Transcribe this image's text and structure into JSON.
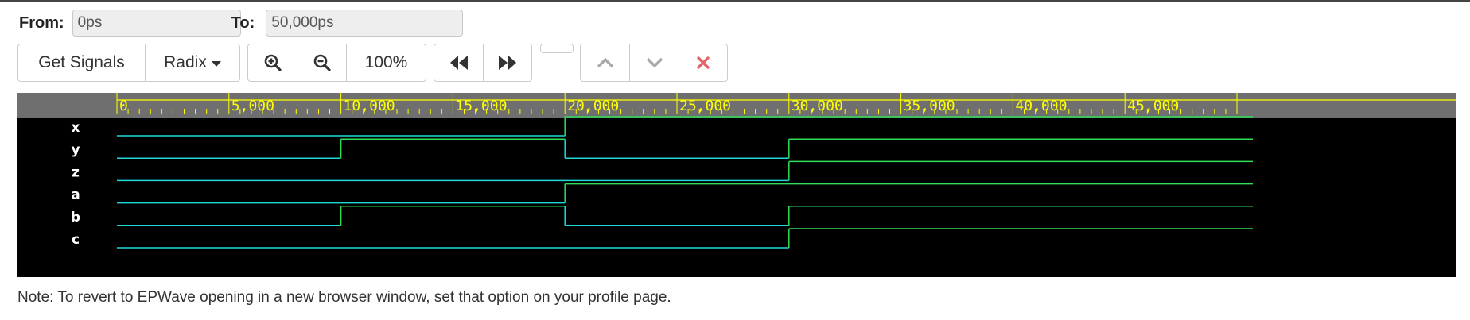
{
  "range": {
    "from_label": "From:",
    "from_value": "0ps",
    "to_label": "To:",
    "to_value": "50,000ps"
  },
  "toolbar": {
    "get_signals_label": "Get Signals",
    "radix_label": "Radix",
    "zoom_level": "100%",
    "icons": {
      "zoom_in": "zoom-in-icon",
      "zoom_out": "zoom-out-icon",
      "rewind": "fast-backward-icon",
      "forward": "fast-forward-icon",
      "up": "chevron-up-icon",
      "down": "chevron-down-icon",
      "close": "close-icon"
    }
  },
  "waveform": {
    "time_start": 0,
    "time_end": 50000,
    "tick_step": 500,
    "major_step": 5000,
    "tick_labels": [
      "0",
      "5,000",
      "10,000",
      "15,000",
      "20,000",
      "25,000",
      "30,000",
      "35,000",
      "40,000",
      "45,000"
    ],
    "signals": [
      {
        "name": "x",
        "transitions": [
          [
            0,
            0
          ],
          [
            20000,
            1
          ]
        ]
      },
      {
        "name": "y",
        "transitions": [
          [
            0,
            0
          ],
          [
            10000,
            1
          ],
          [
            20000,
            0
          ],
          [
            30000,
            1
          ]
        ]
      },
      {
        "name": "z",
        "transitions": [
          [
            0,
            0
          ],
          [
            30000,
            1
          ]
        ]
      },
      {
        "name": "a",
        "transitions": [
          [
            0,
            0
          ],
          [
            20000,
            1
          ]
        ]
      },
      {
        "name": "b",
        "transitions": [
          [
            0,
            0
          ],
          [
            10000,
            1
          ],
          [
            20000,
            0
          ],
          [
            30000,
            1
          ]
        ]
      },
      {
        "name": "c",
        "transitions": [
          [
            0,
            0
          ],
          [
            30000,
            1
          ]
        ]
      }
    ],
    "colors": {
      "ruler_bg": "#6f6f6f",
      "ruler_fg": "#ffff00",
      "low_level": "#1fd9d9",
      "high_level": "#2ede58",
      "background": "#000000",
      "signal_name": "#ffffff"
    }
  },
  "note": "Note: To revert to EPWave opening in a new browser window, set that option on your profile page."
}
